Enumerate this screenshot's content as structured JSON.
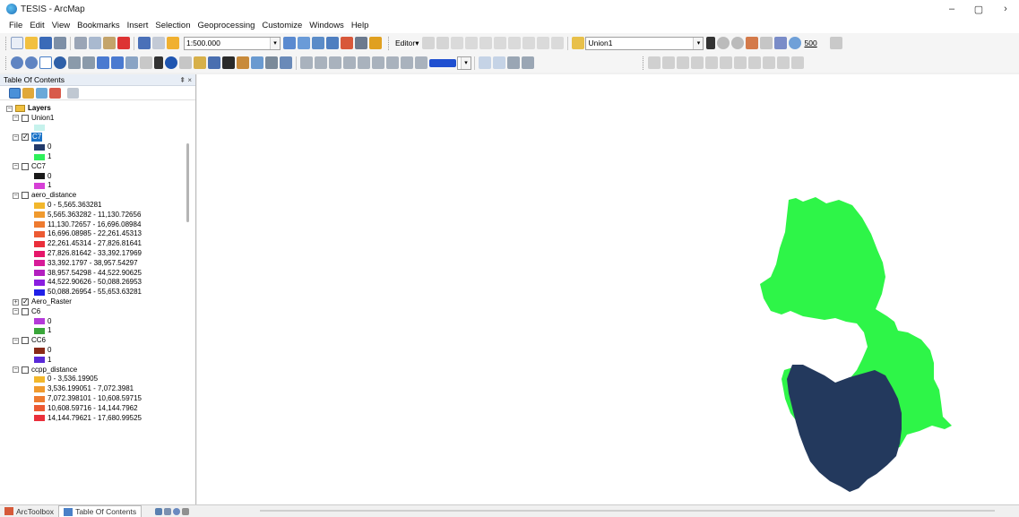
{
  "window": {
    "title": "TESIS - ArcMap",
    "min": "–",
    "max": "▢",
    "close": "›"
  },
  "menu": [
    "File",
    "Edit",
    "View",
    "Bookmarks",
    "Insert",
    "Selection",
    "Geoprocessing",
    "Customize",
    "Windows",
    "Help"
  ],
  "toolbar": {
    "scale_value": "1:500.000",
    "editor_label": "Editor▾",
    "layer_combo": "Union1",
    "tolerance_value": "500"
  },
  "toc": {
    "title": "Table Of Contents",
    "pin": "⇞ ×",
    "root": "Layers",
    "layers": [
      {
        "name": "Union1",
        "checked": false,
        "selected": false,
        "expanded": true,
        "legend": [
          {
            "color": "#c6f2ec",
            "label": ""
          }
        ]
      },
      {
        "name": "C7",
        "checked": true,
        "selected": true,
        "expanded": true,
        "legend": [
          {
            "color": "#223a6a",
            "label": "0"
          },
          {
            "color": "#2ef05a",
            "label": "1"
          }
        ]
      },
      {
        "name": "CC7",
        "checked": false,
        "selected": false,
        "expanded": true,
        "legend": [
          {
            "color": "#1a1a1a",
            "label": "0"
          },
          {
            "color": "#d63fd6",
            "label": "1"
          }
        ]
      },
      {
        "name": "aero_distance",
        "checked": false,
        "selected": false,
        "expanded": true,
        "legend": [
          {
            "color": "#f2b72c",
            "label": "0 - 5,565.363281"
          },
          {
            "color": "#f09a2e",
            "label": "5,565.363282 - 11,130.72656"
          },
          {
            "color": "#ee7b30",
            "label": "11,130.72657 - 16,696.08984"
          },
          {
            "color": "#ec5a33",
            "label": "16,696.08985 - 22,261.45313"
          },
          {
            "color": "#ea2f3b",
            "label": "22,261.45314 - 27,826.81641"
          },
          {
            "color": "#e6176a",
            "label": "27,826.81642 - 33,392.17969"
          },
          {
            "color": "#d71b98",
            "label": "33,392.1797 - 38,957.54297"
          },
          {
            "color": "#b31fbf",
            "label": "38,957.54298 - 44,522.90625"
          },
          {
            "color": "#8a1ee0",
            "label": "44,522.90626 - 50,088.26953"
          },
          {
            "color": "#2020e8",
            "label": "50,088.26954 - 55,653.63281"
          }
        ]
      },
      {
        "name": "Aero_Raster",
        "checked": true,
        "selected": false,
        "expanded": false,
        "legend": []
      },
      {
        "name": "C6",
        "checked": false,
        "selected": false,
        "expanded": true,
        "legend": [
          {
            "color": "#b43ad8",
            "label": "0"
          },
          {
            "color": "#3aa63a",
            "label": "1"
          }
        ]
      },
      {
        "name": "CC6",
        "checked": false,
        "selected": false,
        "expanded": true,
        "legend": [
          {
            "color": "#8a2a18",
            "label": "0"
          },
          {
            "color": "#5a2ad8",
            "label": "1"
          }
        ]
      },
      {
        "name": "ccpp_distance",
        "checked": false,
        "selected": false,
        "expanded": true,
        "legend": [
          {
            "color": "#f2b72c",
            "label": "0 - 3,536.19905"
          },
          {
            "color": "#f09a2e",
            "label": "3,536.199051 - 7,072.3981"
          },
          {
            "color": "#ee7b30",
            "label": "7,072.398101 - 10,608.59715"
          },
          {
            "color": "#ec5a33",
            "label": "10,608.59716 - 14,144.7962"
          },
          {
            "color": "#ea2f3b",
            "label": "14,144.79621 - 17,680.99525"
          }
        ]
      }
    ]
  },
  "bottom_tabs": [
    "ArcToolbox",
    "Table Of Contents"
  ],
  "map": {
    "green": "#2ef548",
    "navy": "#23395d"
  }
}
